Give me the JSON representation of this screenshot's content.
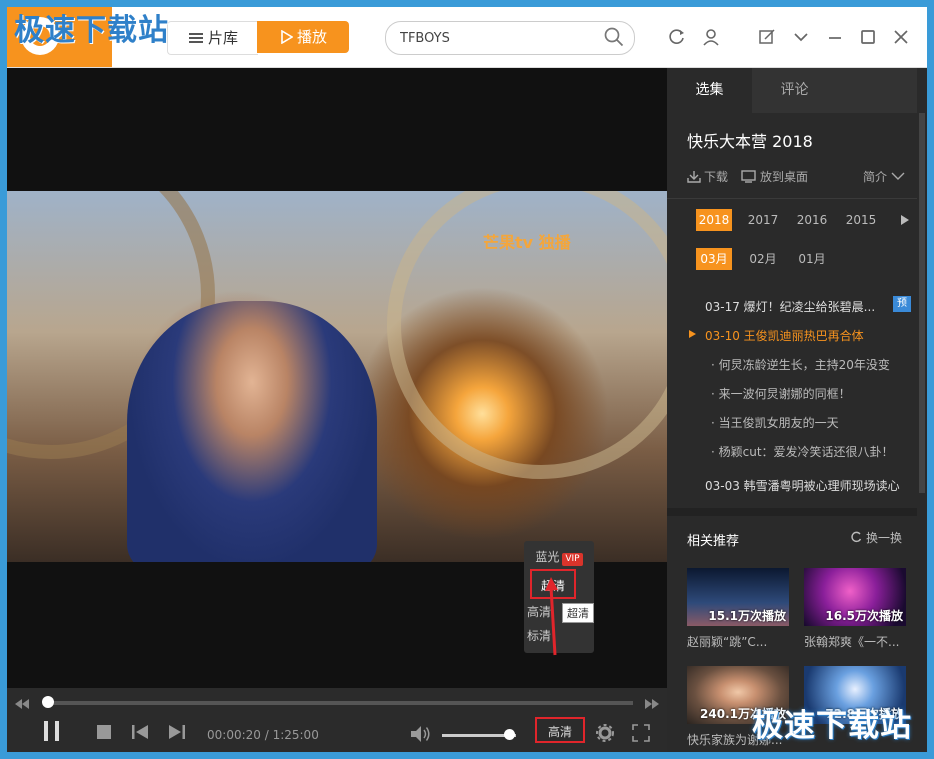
{
  "watermark": "极速下载站",
  "nav": {
    "library": "片库",
    "play": "播放"
  },
  "search": {
    "value": "TFBOYS"
  },
  "video": {
    "channel_logo": "芒果tv 独播"
  },
  "controls": {
    "time": "00:00:20 / 1:25:00",
    "quality": "高清",
    "progress": 0.003,
    "volume": 0.9
  },
  "quality_menu": {
    "items": [
      "蓝光",
      "超清",
      "高清",
      "标清"
    ],
    "vip": "VIP",
    "tooltip": "超清"
  },
  "side": {
    "tabs": [
      "选集",
      "评论"
    ],
    "title": "快乐大本营 2018",
    "download": "下载",
    "desktop": "放到桌面",
    "intro": "简介",
    "years": [
      "2018",
      "2017",
      "2016",
      "2015"
    ],
    "months": [
      "03月",
      "02月",
      "01月"
    ],
    "episodes": [
      "03-17 爆灯！纪凌尘给张碧晨...",
      "03-10 王俊凯迪丽热巴再合体",
      "何炅冻龄逆生长，主持20年没变",
      "来一波何炅谢娜的同框！",
      "当王俊凯女朋友的一天",
      "杨颖cut：爱发冷笑话还很八卦！",
      "03-03 韩雪潘粤明被心理师现场读心"
    ],
    "preview_badge": "预",
    "recommend": {
      "heading": "相关推荐",
      "refresh": "换一换",
      "items": [
        {
          "plays": "15.1万次播放",
          "title": "赵丽颖“跳”C..."
        },
        {
          "plays": "16.5万次播放",
          "title": "张翰郑爽《一不..."
        },
        {
          "plays": "240.1万次播放",
          "title": "快乐家族为谢娜..."
        },
        {
          "plays": "72.8万次播放",
          "title": ""
        }
      ]
    }
  },
  "colors": {
    "accent": "#f7931e",
    "highlight": "#e0252b",
    "titlebar_blue": "#3a9bd8"
  }
}
